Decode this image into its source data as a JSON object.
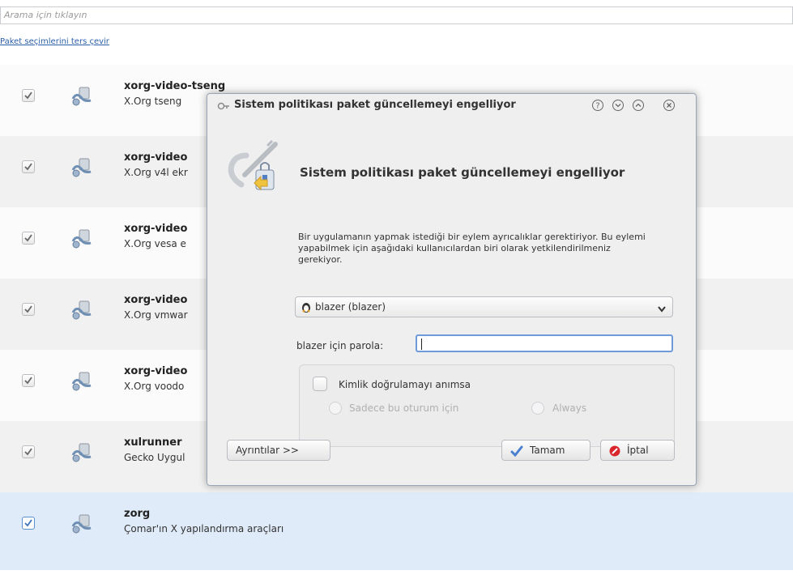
{
  "search": {
    "placeholder": "Arama için tıklayın"
  },
  "invert_link": "Paket seçimlerini ters çevir",
  "packages": [
    {
      "name": "xorg-video-tseng",
      "desc": "X.Org tseng",
      "checked": true
    },
    {
      "name": "xorg-video",
      "desc": "X.Org v4l ekr",
      "checked": true
    },
    {
      "name": "xorg-video",
      "desc": "X.Org vesa e",
      "checked": true
    },
    {
      "name": "xorg-video",
      "desc": "X.Org vmwar",
      "checked": true
    },
    {
      "name": "xorg-video",
      "desc": "X.Org voodo",
      "checked": true
    },
    {
      "name": "xulrunner",
      "desc": "Gecko Uygul",
      "checked": true
    },
    {
      "name": "zorg",
      "desc": "Çomar'ın X yapılandırma araçları",
      "checked": true,
      "selected": true
    }
  ],
  "dialog": {
    "title": "Sistem politikası paket güncellemeyi engelliyor",
    "heading": "Sistem politikası paket güncellemeyi engelliyor",
    "message": "Bir uygulamanın yapmak istediği bir eylem ayrıcalıklar gerektiriyor. Bu eylemi yapabilmek için aşağıdaki kullanıcılardan biri olarak yetkilendirilmeniz gerekiyor.",
    "user_combo": "blazer (blazer)",
    "password_label": "blazer için parola:",
    "password_value": "",
    "remember_label": "Kimlik doğrulamayı anımsa",
    "radio_session": "Sadece bu oturum için",
    "radio_always": "Always",
    "details_button": "Ayrıntılar >>",
    "ok_button": "Tamam",
    "cancel_button": "İptal"
  },
  "colors": {
    "selection": "#dfebf8",
    "link": "#2a5ea8",
    "focus": "#6e9bd8",
    "cancel_icon": "#d8262c",
    "ok_icon": "#4a7fd0"
  }
}
